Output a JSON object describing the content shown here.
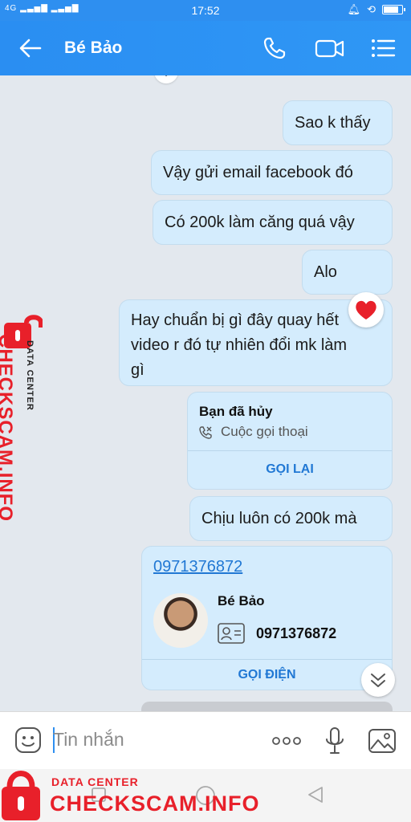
{
  "status_bar": {
    "network": "4G",
    "time": "17:52",
    "battery_level": 0.8
  },
  "header": {
    "title": "Bé Bảo"
  },
  "messages": [
    {
      "text": "Sao k thấy"
    },
    {
      "text": "Vậy gửi email facebook đó"
    },
    {
      "text": "Có 200k làm căng quá vậy"
    },
    {
      "text": "Alo"
    },
    {
      "lines": [
        "Hay chuẩn bị gì đây quay hết",
        "video r đó tự nhiên đổi mk làm",
        "gì"
      ]
    },
    {
      "text": "Chịu luôn có 200k mà"
    }
  ],
  "call_card": {
    "title": "Bạn đã hủy",
    "subtitle": "Cuộc gọi thoại",
    "action": "GỌI LẠI"
  },
  "contact_card": {
    "phone_link": "0971376872",
    "name": "Bé Bảo",
    "phone": "0971376872",
    "action": "GỌI ĐIỆN"
  },
  "composer": {
    "placeholder": "Tin nhắn"
  },
  "watermark": {
    "label": "DATA CENTER",
    "brand": "CHECKSCAM.INFO"
  },
  "colors": {
    "accent": "#2e8ff0",
    "bubble": "#d4ecfd",
    "link": "#2178d4",
    "watermark": "#e8202a"
  }
}
